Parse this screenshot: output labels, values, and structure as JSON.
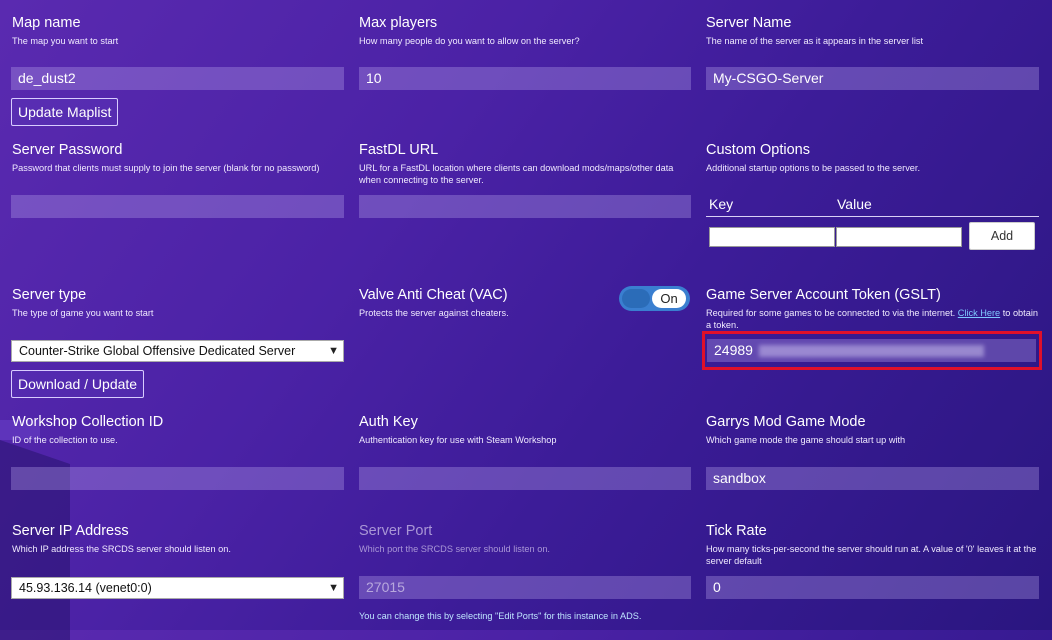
{
  "map_name": {
    "title": "Map name",
    "desc": "The map you want to start",
    "value": "de_dust2",
    "button": "Update Maplist"
  },
  "max_players": {
    "title": "Max players",
    "desc": "How many people do you want to allow on the server?",
    "value": "10"
  },
  "server_name": {
    "title": "Server Name",
    "desc": "The name of the server as it appears in the server list",
    "value": "My-CSGO-Server"
  },
  "server_password": {
    "title": "Server Password",
    "desc": "Password that clients must supply to join the server (blank for no password)",
    "value": ""
  },
  "fastdl": {
    "title": "FastDL URL",
    "desc": "URL for a FastDL location where clients can download mods/maps/other data when connecting to the server.",
    "value": ""
  },
  "custom_options": {
    "title": "Custom Options",
    "desc": "Additional startup options to be passed to the server.",
    "key_header": "Key",
    "value_header": "Value",
    "add_label": "Add"
  },
  "server_type": {
    "title": "Server type",
    "desc": "The type of game you want to start",
    "selected": "Counter-Strike Global Offensive Dedicated Server",
    "button": "Download / Update"
  },
  "vac": {
    "title": "Valve Anti Cheat (VAC)",
    "desc": "Protects the server against cheaters.",
    "toggle_label": "On",
    "enabled": true
  },
  "gslt": {
    "title": "Game Server Account Token (GSLT)",
    "desc_prefix": "Required for some games to be connected to via the internet. ",
    "link": "Click Here",
    "desc_suffix": " to obtain a token.",
    "value_visible": "24989",
    "highlight_color": "#e0102a"
  },
  "workshop": {
    "title": "Workshop Collection ID",
    "desc": "ID of the collection to use.",
    "value": ""
  },
  "auth_key": {
    "title": "Auth Key",
    "desc": "Authentication key for use with Steam Workshop",
    "value": ""
  },
  "gmod_mode": {
    "title": "Garrys Mod Game Mode",
    "desc": "Which game mode the game should start up with",
    "value": "sandbox"
  },
  "server_ip": {
    "title": "Server IP Address",
    "desc": "Which IP address the SRCDS server should listen on.",
    "selected": "45.93.136.14 (venet0:0)"
  },
  "server_port": {
    "title": "Server Port",
    "desc": "Which port the SRCDS server should listen on.",
    "value": "27015",
    "note": "You can change this by selecting \"Edit Ports\" for this instance in ADS."
  },
  "tick_rate": {
    "title": "Tick Rate",
    "desc": "How many ticks-per-second the server should run at. A value of '0' leaves it at the server default",
    "value": "0"
  },
  "colors": {
    "toggle_on": "#3a7fd0",
    "input_bg": "rgba(190,170,240,0.32)"
  }
}
